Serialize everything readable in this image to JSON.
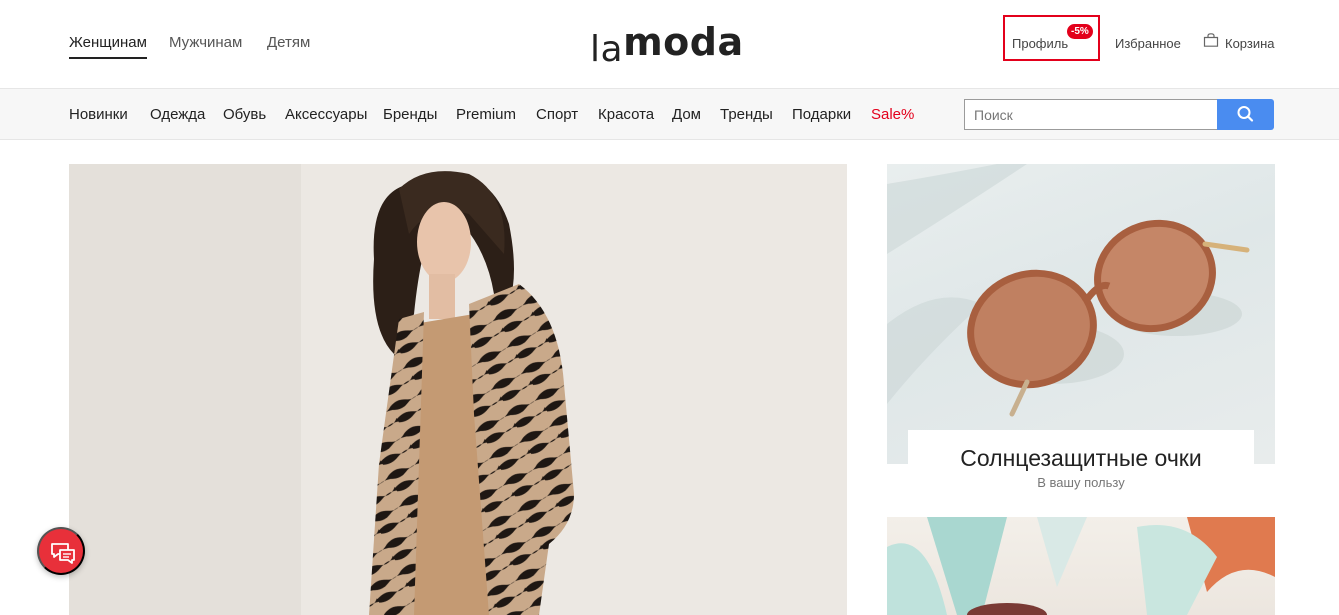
{
  "header": {
    "gender_tabs": [
      "Женщинам",
      "Мужчинам",
      "Детям"
    ],
    "logo_text": {
      "part1": "la",
      "part2": "moda"
    },
    "profile_label": "Профиль",
    "promo_badge": "-5%",
    "favorites_label": "Избранное",
    "cart_label": "Корзина"
  },
  "categories": [
    "Новинки",
    "Одежда",
    "Обувь",
    "Аксессуары",
    "Бренды",
    "Premium",
    "Спорт",
    "Красота",
    "Дом",
    "Тренды",
    "Подарки",
    "Sale%"
  ],
  "search": {
    "placeholder": "Поиск"
  },
  "promo_cards": [
    {
      "title": "Солнцезащитные очки",
      "subtitle": "В вашу пользу"
    }
  ],
  "icons": {
    "search": "magnifier-icon",
    "cart": "shopping-bag-icon",
    "chat": "chat-bubbles-icon"
  },
  "colors": {
    "accent_red": "#e3001b",
    "search_blue": "#4a8cf0",
    "chat_red": "#e8303a",
    "text_dark": "#222222",
    "bar_bg": "#f7f7f7"
  }
}
